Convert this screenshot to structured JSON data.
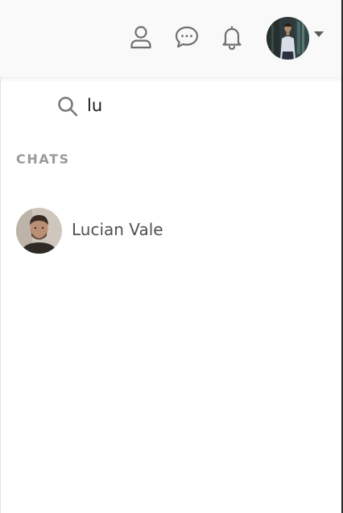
{
  "header": {
    "icons": {
      "profile": "user-icon",
      "messages": "chat-bubble-icon",
      "notifications": "bell-icon",
      "menu": "chevron-down-icon"
    },
    "avatar_alt": "Current user avatar"
  },
  "search": {
    "value": "lu",
    "icon": "search-icon"
  },
  "results": {
    "section_label": "CHATS",
    "chats": [
      {
        "name": "Lucian Vale"
      }
    ]
  },
  "colors": {
    "icon": "#6f6f6f",
    "section_label": "#9a9a9a",
    "chat_name": "#505050",
    "header_bg": "#f9f9f9"
  }
}
